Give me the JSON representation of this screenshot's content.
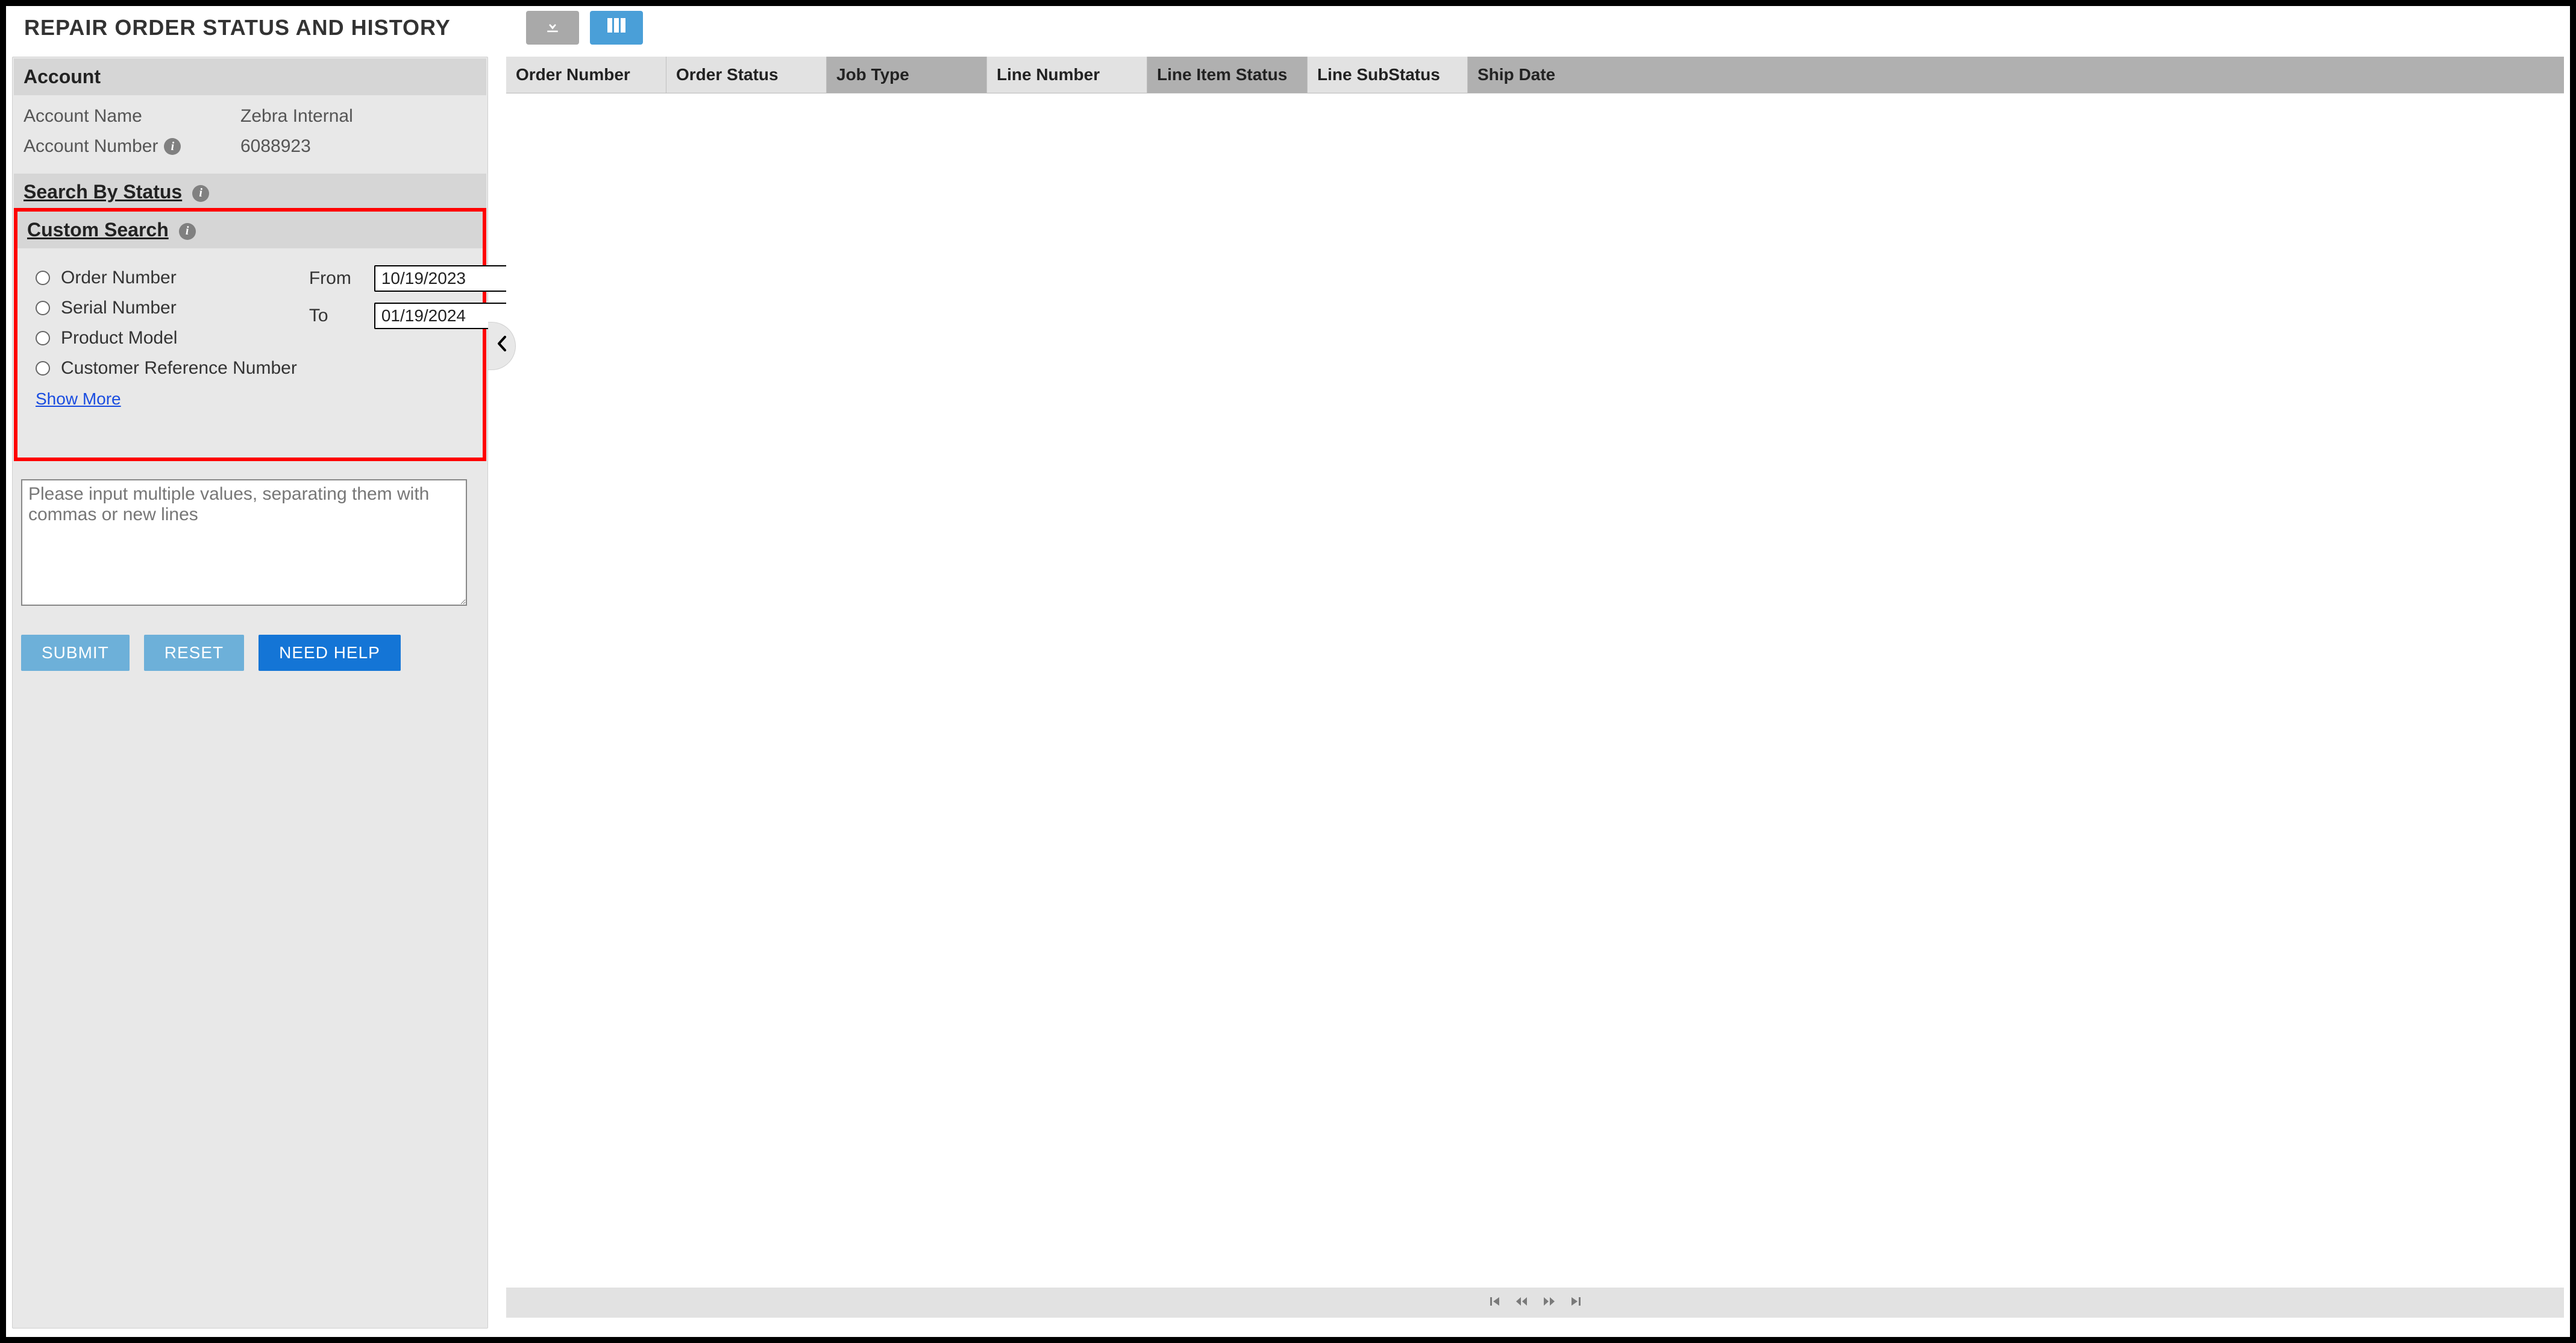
{
  "page_title": "REPAIR ORDER STATUS AND HISTORY",
  "icons": {
    "download": "download-icon",
    "columns": "columns-icon",
    "info": "i",
    "calendar": "calendar-icon",
    "chevron_left": "◀"
  },
  "account": {
    "header": "Account",
    "name_label": "Account Name",
    "name_value": "Zebra Internal",
    "number_label": "Account Number",
    "number_value": "6088923"
  },
  "search_by_status": {
    "header": "Search By Status"
  },
  "custom_search": {
    "header": "Custom Search",
    "options": [
      "Order Number",
      "Serial Number",
      "Product Model",
      "Customer Reference Number"
    ],
    "from_label": "From",
    "from_value": "10/19/2023",
    "to_label": "To",
    "to_value": "01/19/2024",
    "show_more": "Show More"
  },
  "multi_input": {
    "placeholder": "Please input multiple values, separating them with commas or new lines"
  },
  "buttons": {
    "submit": "SUBMIT",
    "reset": "RESET",
    "need_help": "NEED HELP"
  },
  "grid": {
    "columns": [
      {
        "label": "Order Number",
        "shade": "light"
      },
      {
        "label": "Order Status",
        "shade": "light"
      },
      {
        "label": "Job Type",
        "shade": "dark"
      },
      {
        "label": "Line Number",
        "shade": "light"
      },
      {
        "label": "Line Item Status",
        "shade": "dark"
      },
      {
        "label": "Line SubStatus",
        "shade": "light"
      },
      {
        "label": "Ship Date",
        "shade": "dark"
      }
    ],
    "rows": [],
    "pager": {
      "first": "|◀",
      "prev": "◀◀",
      "next": "▶▶",
      "last": "▶|"
    }
  }
}
